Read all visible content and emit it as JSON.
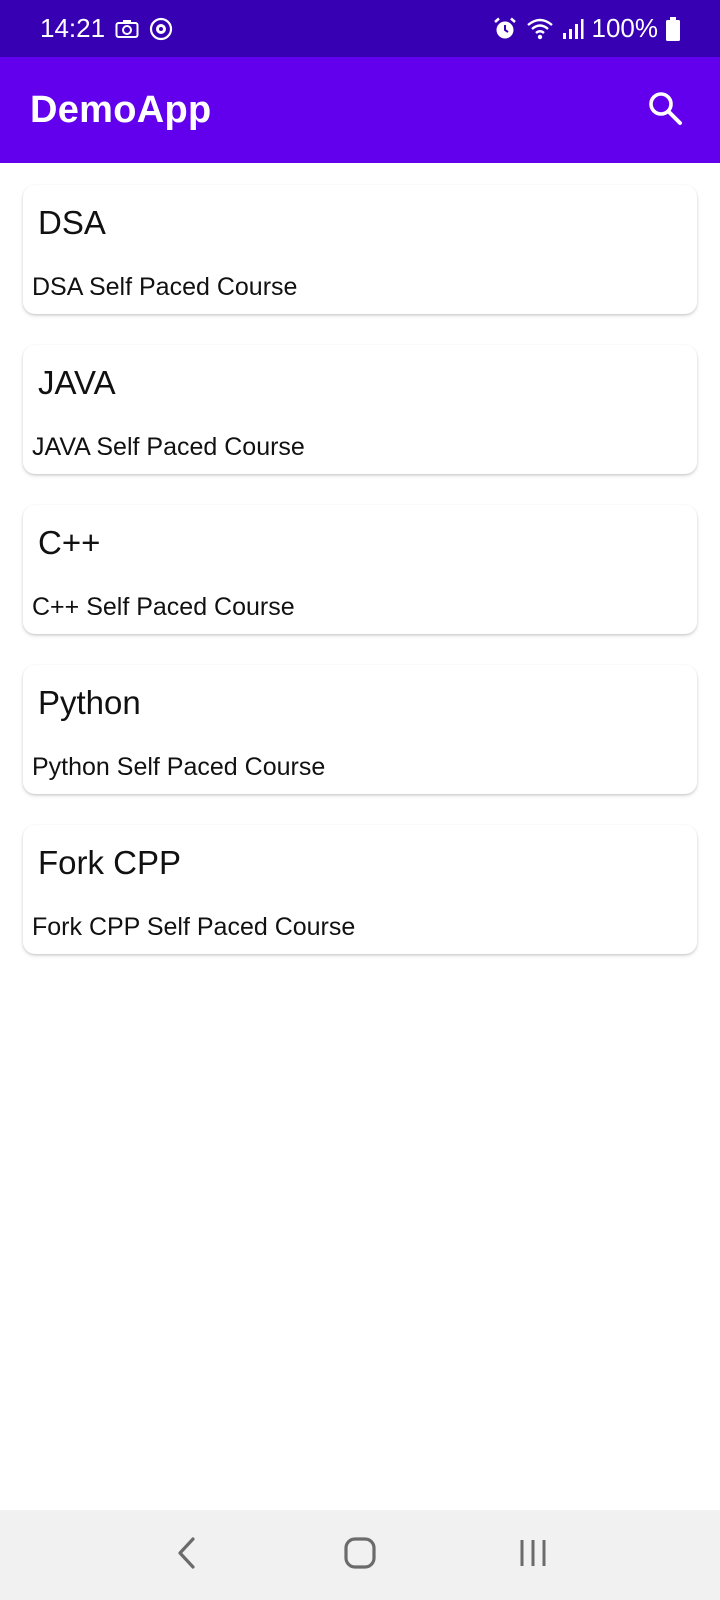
{
  "status_bar": {
    "time": "14:21",
    "battery": "100%",
    "icons": [
      "camera-icon",
      "vpn-icon",
      "alarm-icon",
      "wifi-icon",
      "signal-icon",
      "battery-icon"
    ]
  },
  "app_bar": {
    "title": "DemoApp",
    "search_icon": "search-icon"
  },
  "courses": [
    {
      "title": "DSA",
      "subtitle": "DSA Self Paced Course"
    },
    {
      "title": "JAVA",
      "subtitle": "JAVA Self Paced Course"
    },
    {
      "title": "C++",
      "subtitle": "C++ Self Paced Course"
    },
    {
      "title": "Python",
      "subtitle": "Python Self Paced Course"
    },
    {
      "title": "Fork CPP",
      "subtitle": "Fork CPP Self Paced Course"
    }
  ],
  "nav_bar": {
    "icons": [
      "back-icon",
      "home-icon",
      "recents-icon"
    ]
  },
  "colors": {
    "status_bar": "#3700b3",
    "app_bar": "#6200ee",
    "nav_bar": "#f1f1f1"
  }
}
